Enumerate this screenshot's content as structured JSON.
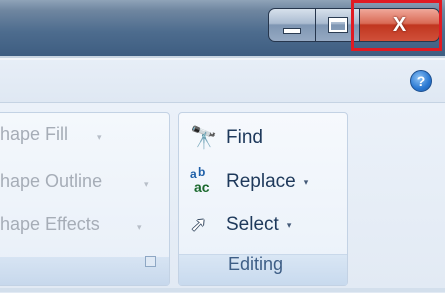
{
  "window_controls": {
    "minimize_icon": "minimize-icon",
    "maximize_icon": "maximize-icon",
    "close_icon": "close-icon",
    "close_glyph": "X",
    "highlight_color": "#e01b23"
  },
  "help": {
    "glyph": "?",
    "icon": "help-icon"
  },
  "drawing_group": {
    "items": [
      {
        "label": "hape Fill",
        "arrow": "▾"
      },
      {
        "label": "hape Outline",
        "arrow": "▾"
      },
      {
        "label": "hape Effects",
        "arrow": "▾"
      }
    ],
    "launcher_icon": "dialog-launcher-icon"
  },
  "editing_group": {
    "label": "Editing",
    "find": {
      "label": "Find",
      "icon": "binoculars-icon",
      "glyph": "🔭"
    },
    "replace": {
      "label": "Replace",
      "arrow": "▾",
      "icon": "replace-icon",
      "glyph_a": "a",
      "glyph_b": "b",
      "glyph_ac": "ac"
    },
    "select": {
      "label": "Select",
      "arrow": "▾",
      "icon": "cursor-icon",
      "glyph": "➚"
    }
  }
}
